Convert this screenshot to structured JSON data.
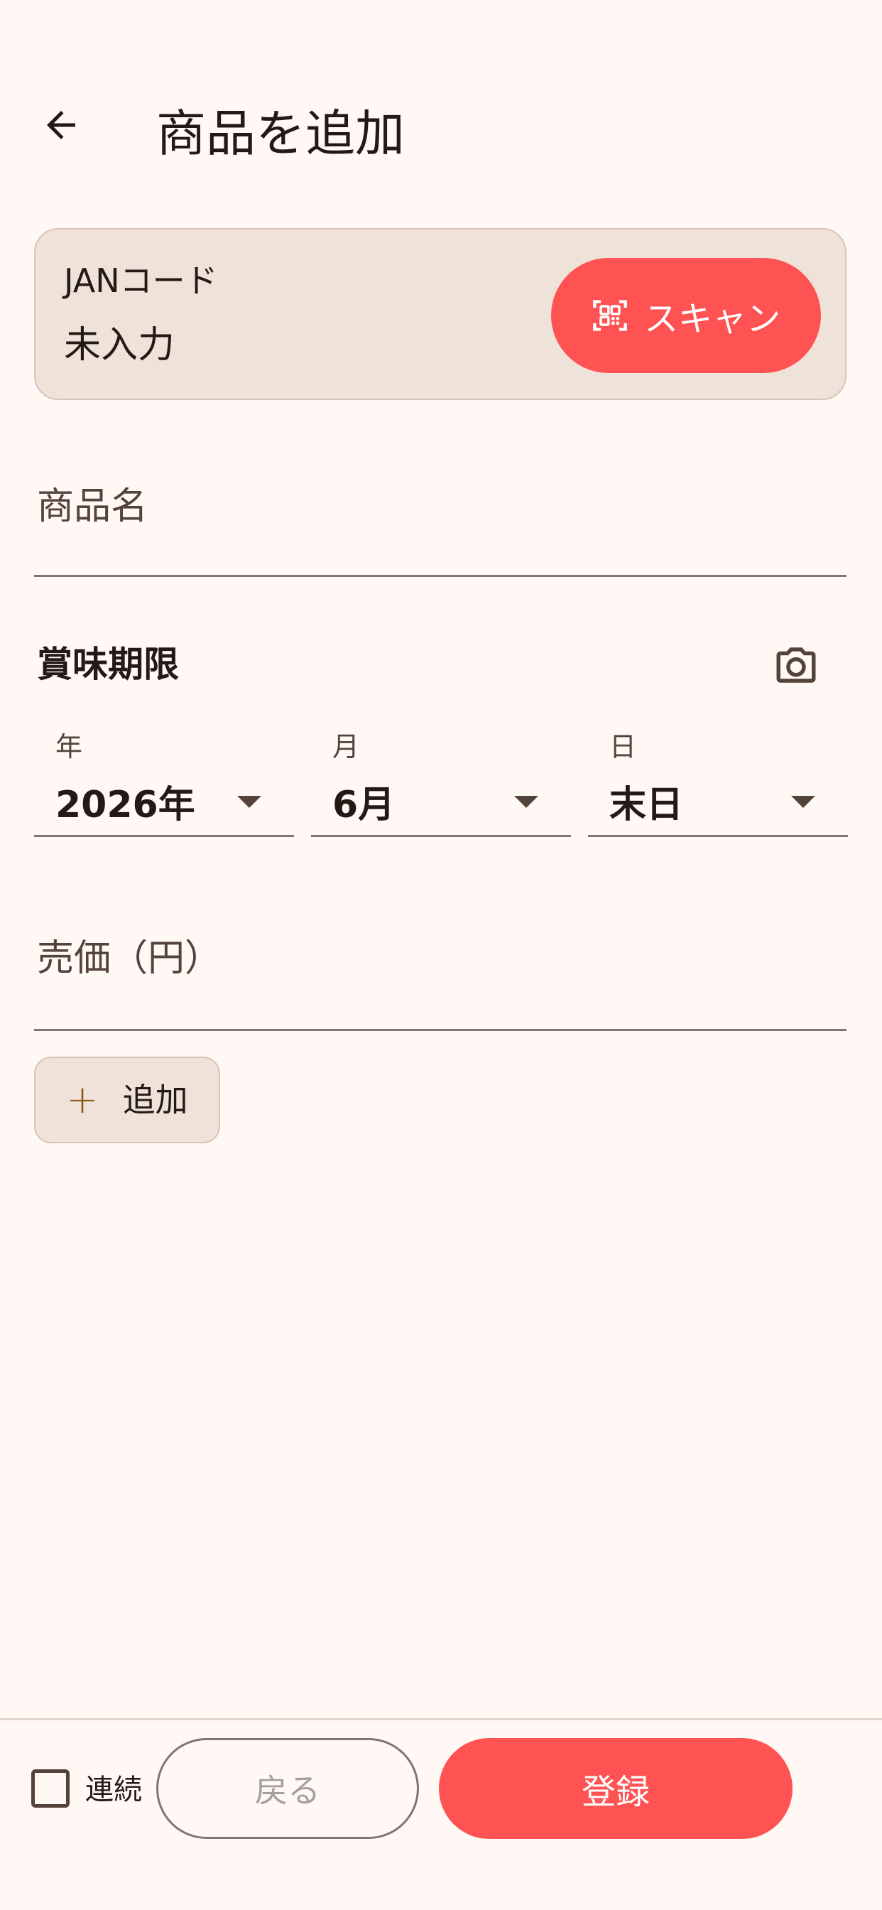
{
  "header": {
    "title": "商品を追加"
  },
  "jan": {
    "label": "JANコード",
    "value": "未入力",
    "scan_label": "スキャン"
  },
  "product_name": {
    "label": "商品名"
  },
  "expiry": {
    "title": "賞味期限",
    "year": {
      "label": "年",
      "value": "2026年"
    },
    "month": {
      "label": "月",
      "value": "6月"
    },
    "day": {
      "label": "日",
      "value": "末日"
    }
  },
  "price": {
    "label": "売価（円）"
  },
  "add_button": {
    "label": "追加"
  },
  "bottom": {
    "continuous_label": "連続",
    "back_label": "戻る",
    "submit_label": "登録"
  },
  "colors": {
    "background": "#FFF8F5",
    "accent": "#FF5252",
    "card": "#EFE2D8",
    "text": "#231A16",
    "muted_text": "#54433B"
  }
}
